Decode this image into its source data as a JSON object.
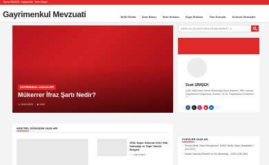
{
  "topbar": {
    "text": "Sural 2/5/2025 · Kategoriler · Bize Ulaşın"
  },
  "header": {
    "logo": "Gayrimenkul Mevzuati",
    "nav": [
      "Mülk Emlak",
      "İmar Barışı",
      "İmar Hukuku",
      "Eşya Hukuku",
      "Tüm Konular",
      "Kentsel Dönüşüm"
    ]
  },
  "hero": {
    "tag": "GAYRİMENKUL ANALİZLERİ",
    "title": "Mükerrer İfraz Şartı Nedir?",
    "date": "19/02/2025",
    "views": "1000",
    "colors": {
      "accent": "#e02a2a"
    }
  },
  "search": {
    "placeholder": "VARDI GÜ İÇİ NEVP NEW ERVAN MARKET JI"
  },
  "profile": {
    "name": "Suat ŞİMŞEK",
    "bio": "ÇŞB. Milli Emlak Genel Müdürlüğü Daire Başkanı, SPK Lisanslı Gayrimenkul Değerleme Uzmanı, Ye.Dr. Gayrimenkul Geliştirme Y...",
    "socials": [
      {
        "icon": "facebook-icon",
        "label": "f",
        "color": "#3b5998"
      },
      {
        "icon": "twitter-icon",
        "label": "t",
        "color": "#222222"
      },
      {
        "icon": "instagram-icon",
        "label": "i",
        "color": "#c13584"
      },
      {
        "icon": "youtube-icon",
        "label": "▶",
        "color": "#e02a2a"
      },
      {
        "icon": "linkedin-icon",
        "label": "in",
        "color": "#0077b5"
      },
      {
        "icon": "quote-icon",
        "label": "”",
        "color": "#ffffff"
      }
    ]
  },
  "popular": {
    "title": "POPÜLER YAZILAR",
    "items": [
      "Emsal Nedir, Nasıl Hesaplanır? KAKS Nedir, Nasıl Hesaplanır? (112.527)",
      "Kaçak Yapılara Elektrik ve Su Aboneliği – 2025 (106.180)"
    ]
  },
  "section": {
    "title": "KENTSEL DÖNÜŞÜM YAZILARI",
    "article_title": "2981 Sayılı Kanuna Göre Hak Sahipliği ve Tapu Tahsis Belgesi",
    "author": "suat şimşek"
  }
}
